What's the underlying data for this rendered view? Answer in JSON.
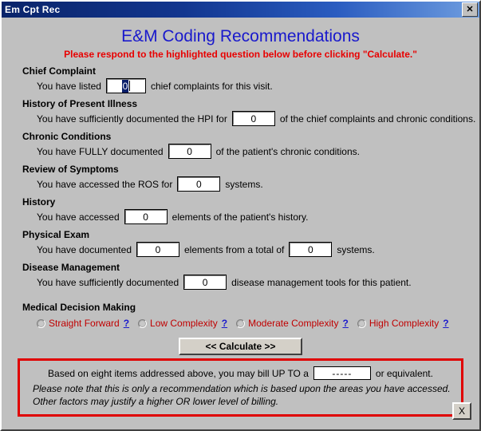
{
  "window": {
    "title": "Em Cpt Rec",
    "close_icon": "close-icon",
    "close_label": "✕"
  },
  "header": {
    "title": "E&M Coding Recommendations",
    "subtitle": "Please respond to the highlighted question below before clicking \"Calculate.\"",
    "title_color": "#1919cc",
    "subtitle_color": "#e80000"
  },
  "sections": [
    {
      "heading": "Chief Complaint",
      "pre_text": "You have listed",
      "value": "0",
      "post_text": "chief complaints for this visit.",
      "focused": true
    },
    {
      "heading": "History of Present Illness",
      "pre_text": "You have sufficiently documented the HPI for",
      "value": "0",
      "post_text": "of the chief complaints and chronic conditions.",
      "focused": false
    },
    {
      "heading": "Chronic Conditions",
      "pre_text": "You have FULLY documented",
      "value": "0",
      "post_text": "of the patient's chronic conditions.",
      "focused": false
    },
    {
      "heading": "Review of Symptoms",
      "pre_text": "You have accessed the ROS for",
      "value": "0",
      "post_text": "systems.",
      "focused": false
    },
    {
      "heading": "History",
      "pre_text": "You have accessed",
      "value": "0",
      "post_text": "elements of the patient's history.",
      "focused": false
    },
    {
      "heading": "Physical Exam",
      "pre_text": "You have documented",
      "value": "0",
      "mid_text": "elements from a total of",
      "value2": "0",
      "post_text": "systems.",
      "focused": false
    },
    {
      "heading": "Disease Management",
      "pre_text": "You have sufficiently documented",
      "value": "0",
      "post_text": "disease management tools for this patient.",
      "focused": false
    }
  ],
  "medical_decision_making": {
    "heading": "Medical Decision Making",
    "help_label": "?",
    "options": [
      {
        "label": "Straight Forward",
        "selected": false
      },
      {
        "label": "Low Complexity",
        "selected": false
      },
      {
        "label": "Moderate Complexity",
        "selected": false
      },
      {
        "label": "High Complexity",
        "selected": false
      }
    ],
    "label_color": "#c00000",
    "help_color": "#1919cc"
  },
  "calculate": {
    "label": "<<  Calculate  >>"
  },
  "result": {
    "pre_text": "Based on eight items addressed above, you may bill UP TO a",
    "value": "-----",
    "post_text": "or equivalent.",
    "note_line1": "Please note that this is only a recommendation which is based upon the areas you have accessed.",
    "note_line2": "Other factors may justify a higher OR lower level of billing.",
    "border_color": "#e00000"
  },
  "footer": {
    "close_label": "X"
  }
}
